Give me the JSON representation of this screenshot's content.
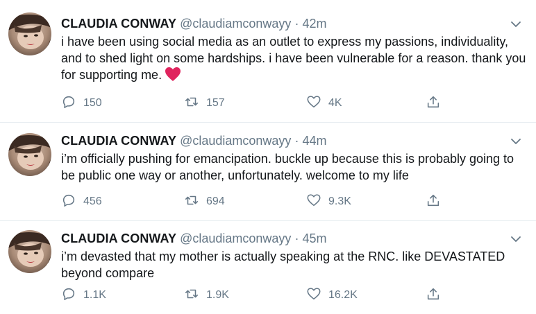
{
  "tweets": [
    {
      "name": "CLAUDIA CONWAY",
      "handle": "@claudiamconwayy",
      "separator": "·",
      "time": "42m",
      "text": "i have been using social media as an outlet to express my passions, individuality, and to shed light on some hardships. i have been vulnerable for a reason. thank you for supporting me.",
      "emoji": "red-heart-emoji",
      "replies": "150",
      "retweets": "157",
      "likes": "4K"
    },
    {
      "name": "CLAUDIA CONWAY",
      "handle": "@claudiamconwayy",
      "separator": "·",
      "time": "44m",
      "text": "i’m officially pushing for emancipation. buckle up because this is probably going to be public one way or another, unfortunately. welcome to my life",
      "replies": "456",
      "retweets": "694",
      "likes": "9.3K"
    },
    {
      "name": "CLAUDIA CONWAY",
      "handle": "@claudiamconwayy",
      "separator": "·",
      "time": "45m",
      "text": "i’m devasted that my mother is actually speaking at the RNC. like DEVASTATED beyond compare",
      "replies": "1.1K",
      "retweets": "1.9K",
      "likes": "16.2K"
    }
  ],
  "colors": {
    "text": "#14171a",
    "secondary": "#657786",
    "divider": "#e6ecf0",
    "heart": "#e0245e"
  },
  "icons": [
    "reply-icon",
    "retweet-icon",
    "like-icon",
    "share-icon",
    "chevron-down-icon"
  ]
}
